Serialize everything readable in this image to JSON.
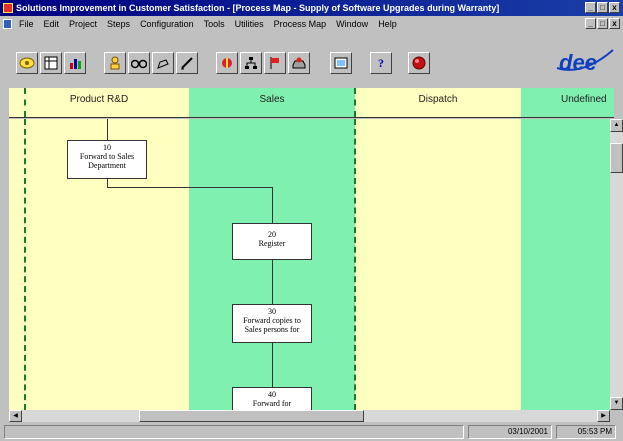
{
  "window": {
    "title": "Solutions Improvement in Customer Satisfaction - [Process Map - Supply of Software Upgrades during Warranty]",
    "minimize": "_",
    "maximize": "□",
    "close": "x"
  },
  "menu": {
    "items": [
      "File",
      "Edit",
      "Project",
      "Steps",
      "Configuration",
      "Tools",
      "Utilities",
      "Process Map",
      "Window",
      "Help"
    ]
  },
  "toolbar": {
    "buttons": [
      "open-icon",
      "grid-icon",
      "chart-icon",
      "person-icon",
      "binoculars-icon",
      "edit-icon",
      "pencil-icon",
      "tools-icon",
      "hierarchy-icon",
      "flag-icon",
      "tray-icon",
      "preview-icon",
      "help-icon",
      "exit-icon"
    ],
    "help_glyph": "?",
    "logo_text": "dee"
  },
  "lanes": [
    {
      "label": "Product R&D",
      "color": "#ffffc0"
    },
    {
      "label": "Sales",
      "color": "#80f0b0"
    },
    {
      "label": "Dispatch",
      "color": "#ffffc0"
    },
    {
      "label": "Undefined",
      "color": "#80f0b0"
    }
  ],
  "steps": [
    {
      "number": "10",
      "line1": "Forward to Sales",
      "line2": "Department"
    },
    {
      "number": "20",
      "line1": "Register",
      "line2": ""
    },
    {
      "number": "30",
      "line1": "Forward copies to",
      "line2": "Sales persons for"
    },
    {
      "number": "40",
      "line1": "Forward for",
      "line2": ""
    }
  ],
  "status": {
    "date": "03/10/2001",
    "time": "05:53 PM"
  },
  "colors": {
    "titlebar": "#000080",
    "lane_yellow": "#ffffc0",
    "lane_green": "#80f0b0",
    "divider": "#1a7a2a"
  }
}
